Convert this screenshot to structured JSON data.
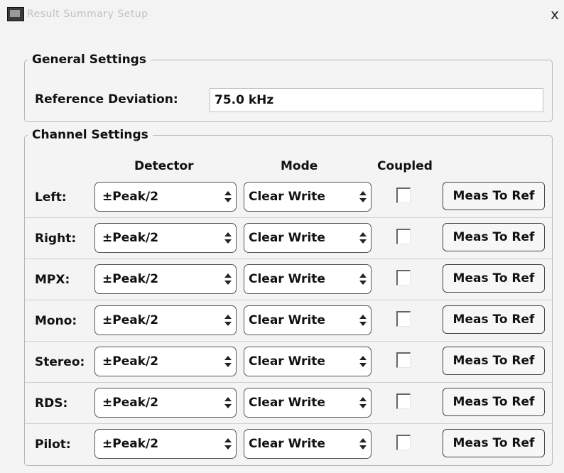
{
  "window": {
    "title": "Result Summary Setup",
    "close_label": "x",
    "icon": "app-window-icon"
  },
  "general": {
    "legend": "General Settings",
    "reference_deviation_label": "Reference Deviation:",
    "reference_deviation_value": "75.0 kHz"
  },
  "channel": {
    "legend": "Channel Settings",
    "headers": {
      "detector": "Detector",
      "mode": "Mode",
      "coupled": "Coupled"
    },
    "rows": [
      {
        "label": "Left:",
        "detector": "±Peak/2",
        "mode": "Clear Write",
        "coupled": false,
        "button": "Meas To Ref"
      },
      {
        "label": "Right:",
        "detector": "±Peak/2",
        "mode": "Clear Write",
        "coupled": false,
        "button": "Meas To Ref"
      },
      {
        "label": "MPX:",
        "detector": "±Peak/2",
        "mode": "Clear Write",
        "coupled": false,
        "button": "Meas To Ref"
      },
      {
        "label": "Mono:",
        "detector": "±Peak/2",
        "mode": "Clear Write",
        "coupled": false,
        "button": "Meas To Ref"
      },
      {
        "label": "Stereo:",
        "detector": "±Peak/2",
        "mode": "Clear Write",
        "coupled": false,
        "button": "Meas To Ref"
      },
      {
        "label": "RDS:",
        "detector": "±Peak/2",
        "mode": "Clear Write",
        "coupled": false,
        "button": "Meas To Ref"
      },
      {
        "label": "Pilot:",
        "detector": "±Peak/2",
        "mode": "Clear Write",
        "coupled": false,
        "button": "Meas To Ref"
      }
    ]
  }
}
